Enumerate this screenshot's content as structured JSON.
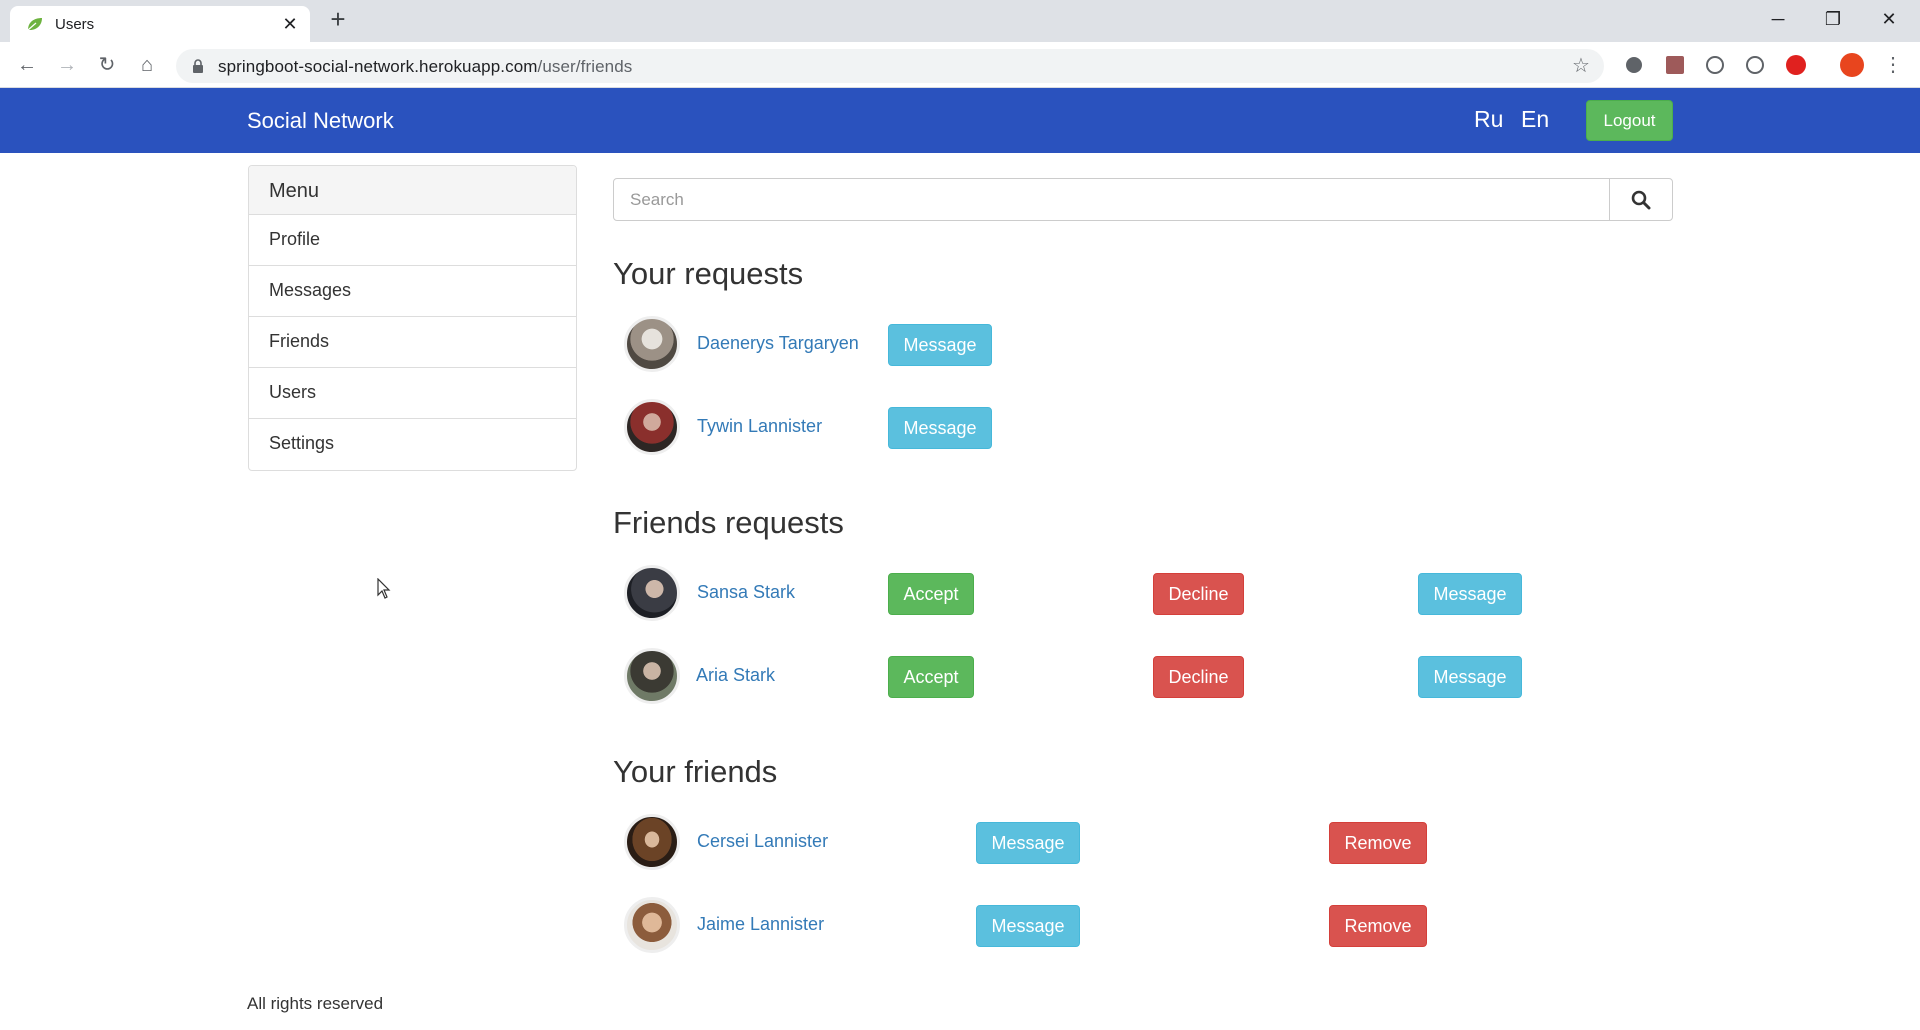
{
  "browser": {
    "tab_title": "Users",
    "new_tab_label": "+",
    "url_host": "springboot-social-network.herokuapp.com",
    "url_path": "/user/friends"
  },
  "navbar": {
    "brand": "Social Network",
    "lang_ru": "Ru",
    "lang_en": "En",
    "logout": "Logout"
  },
  "menu": {
    "title": "Menu",
    "items": [
      {
        "label": "Profile"
      },
      {
        "label": "Messages"
      },
      {
        "label": "Friends"
      },
      {
        "label": "Users"
      },
      {
        "label": "Settings"
      }
    ]
  },
  "search": {
    "placeholder": "Search"
  },
  "your_requests": {
    "title": "Your requests",
    "people": [
      {
        "name": "Daenerys Targaryen",
        "message": "Message"
      },
      {
        "name": "Tywin Lannister",
        "message": "Message"
      }
    ]
  },
  "friends_requests": {
    "title": "Friends requests",
    "people": [
      {
        "name": "Sansa Stark",
        "accept": "Accept",
        "decline": "Decline",
        "message": "Message"
      },
      {
        "name": "Aria Stark",
        "accept": "Accept",
        "decline": "Decline",
        "message": "Message"
      }
    ]
  },
  "your_friends": {
    "title": "Your friends",
    "people": [
      {
        "name": "Cersei Lannister",
        "message": "Message",
        "remove": "Remove"
      },
      {
        "name": "Jaime Lannister",
        "message": "Message",
        "remove": "Remove"
      }
    ]
  },
  "footer": {
    "text": "All rights reserved"
  },
  "colors": {
    "navbar": "#2a52be",
    "link": "#337ab7",
    "info": "#5bc0de",
    "success": "#5cb85c",
    "danger": "#d9534f"
  },
  "icons": {
    "tab_favicon": "leaf-icon",
    "search": "search-icon",
    "bookmark": "star-icon"
  }
}
